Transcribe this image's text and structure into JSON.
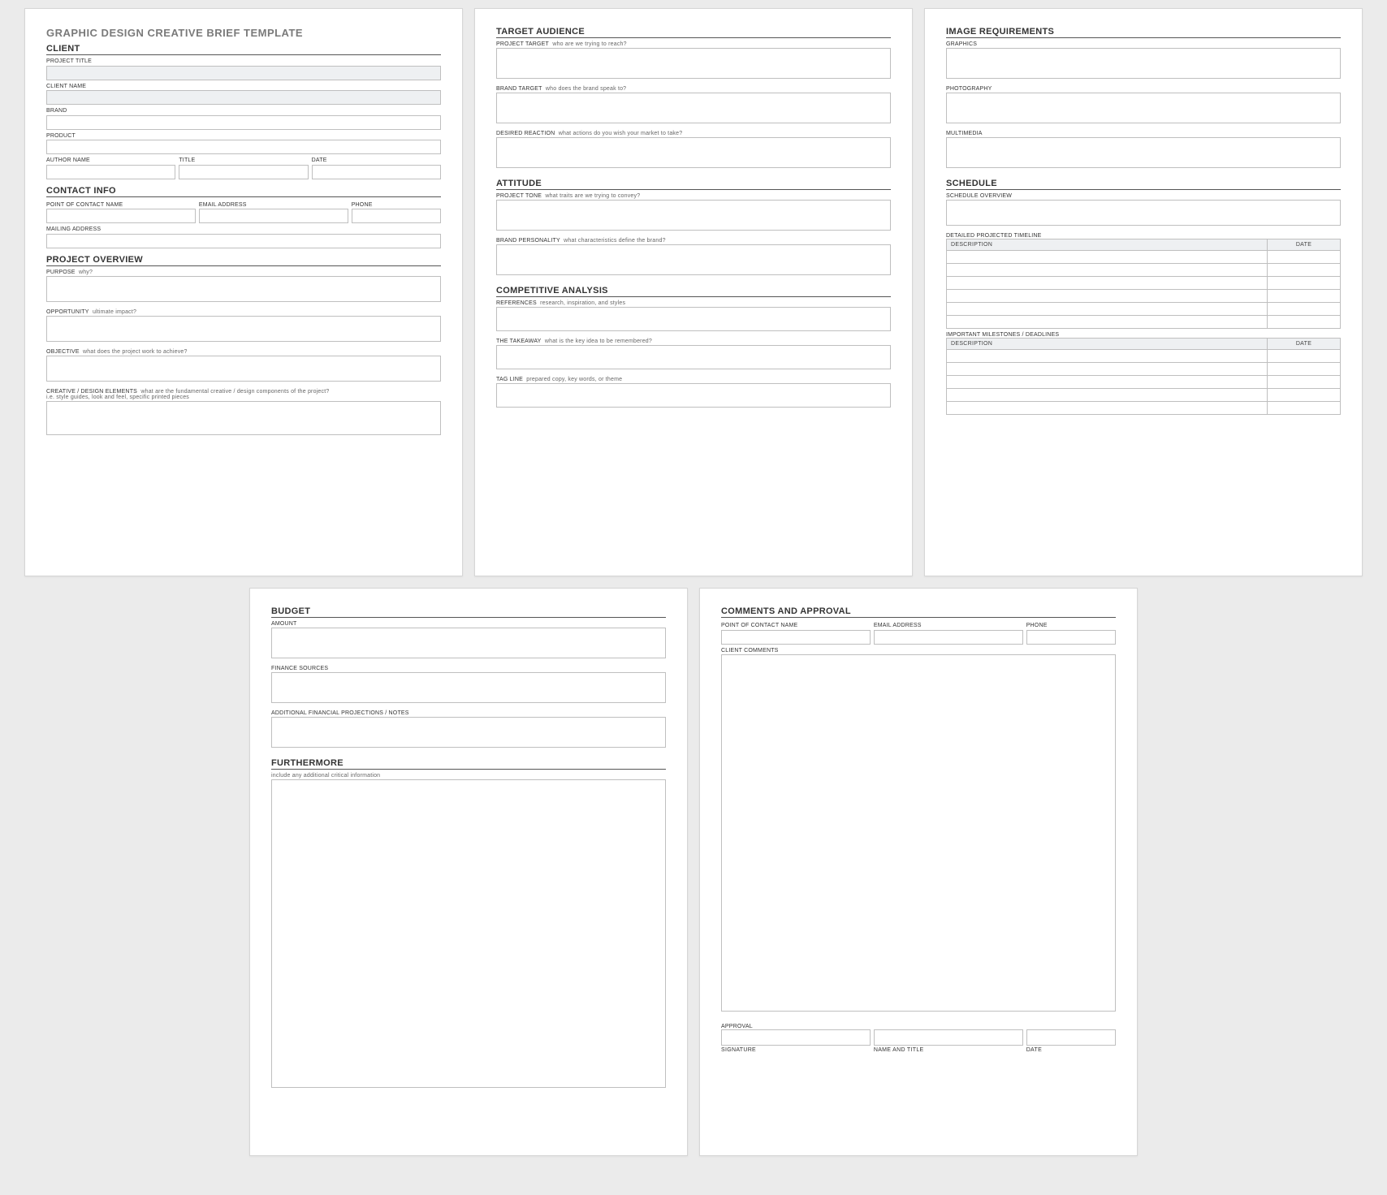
{
  "doc_title": "GRAPHIC DESIGN CREATIVE BRIEF TEMPLATE",
  "p1": {
    "s_client": "CLIENT",
    "project_title": "PROJECT TITLE",
    "client_name": "CLIENT NAME",
    "brand": "BRAND",
    "product": "PRODUCT",
    "author_name": "AUTHOR NAME",
    "title": "TITLE",
    "date": "DATE",
    "s_contact": "CONTACT INFO",
    "poc": "POINT OF CONTACT NAME",
    "email": "EMAIL ADDRESS",
    "phone": "PHONE",
    "mailing": "MAILING ADDRESS",
    "s_overview": "PROJECT OVERVIEW",
    "purpose": "PURPOSE",
    "purpose_hint": "why?",
    "opportunity": "OPPORTUNITY",
    "opportunity_hint": "ultimate impact?",
    "objective": "OBJECTIVE",
    "objective_hint": "what does the project work to achieve?",
    "creative": "CREATIVE / DESIGN ELEMENTS",
    "creative_hint": "what are the fundamental creative / design components of the project?",
    "creative_hint2": "i.e. style guides, look and feel, specific printed pieces"
  },
  "p2": {
    "s_target": "TARGET AUDIENCE",
    "project_target": "PROJECT TARGET",
    "project_target_hint": "who are we trying to reach?",
    "brand_target": "BRAND TARGET",
    "brand_target_hint": "who does the brand speak to?",
    "desired": "DESIRED REACTION",
    "desired_hint": "what actions do you wish your market to take?",
    "s_attitude": "ATTITUDE",
    "project_tone": "PROJECT TONE",
    "project_tone_hint": "what traits are we trying to convey?",
    "brand_personality": "BRAND PERSONALITY",
    "brand_personality_hint": "what characteristics define the brand?",
    "s_competitive": "COMPETITIVE ANALYSIS",
    "references": "REFERENCES",
    "references_hint": "research, inspiration, and styles",
    "takeaway": "THE TAKEAWAY",
    "takeaway_hint": "what is the key idea to be remembered?",
    "tagline": "TAG LINE",
    "tagline_hint": "prepared copy, key words, or theme"
  },
  "p3": {
    "s_image": "IMAGE REQUIREMENTS",
    "graphics": "GRAPHICS",
    "photography": "PHOTOGRAPHY",
    "multimedia": "MULTIMEDIA",
    "s_schedule": "SCHEDULE",
    "schedule_overview": "SCHEDULE OVERVIEW",
    "detailed_timeline": "DETAILED PROJECTED TIMELINE",
    "th_desc": "DESCRIPTION",
    "th_date": "DATE",
    "milestones": "IMPORTANT MILESTONES / DEADLINES"
  },
  "p4": {
    "s_budget": "BUDGET",
    "amount": "AMOUNT",
    "finance": "FINANCE SOURCES",
    "additional": "ADDITIONAL FINANCIAL PROJECTIONS / NOTES",
    "s_furthermore": "FURTHERMORE",
    "furthermore_hint": "include any additional critical information"
  },
  "p5": {
    "s_comments": "COMMENTS AND APPROVAL",
    "poc": "POINT OF CONTACT NAME",
    "email": "EMAIL ADDRESS",
    "phone": "PHONE",
    "client_comments": "CLIENT COMMENTS",
    "approval": "APPROVAL",
    "signature": "SIGNATURE",
    "name_title": "NAME AND TITLE",
    "date": "DATE"
  }
}
